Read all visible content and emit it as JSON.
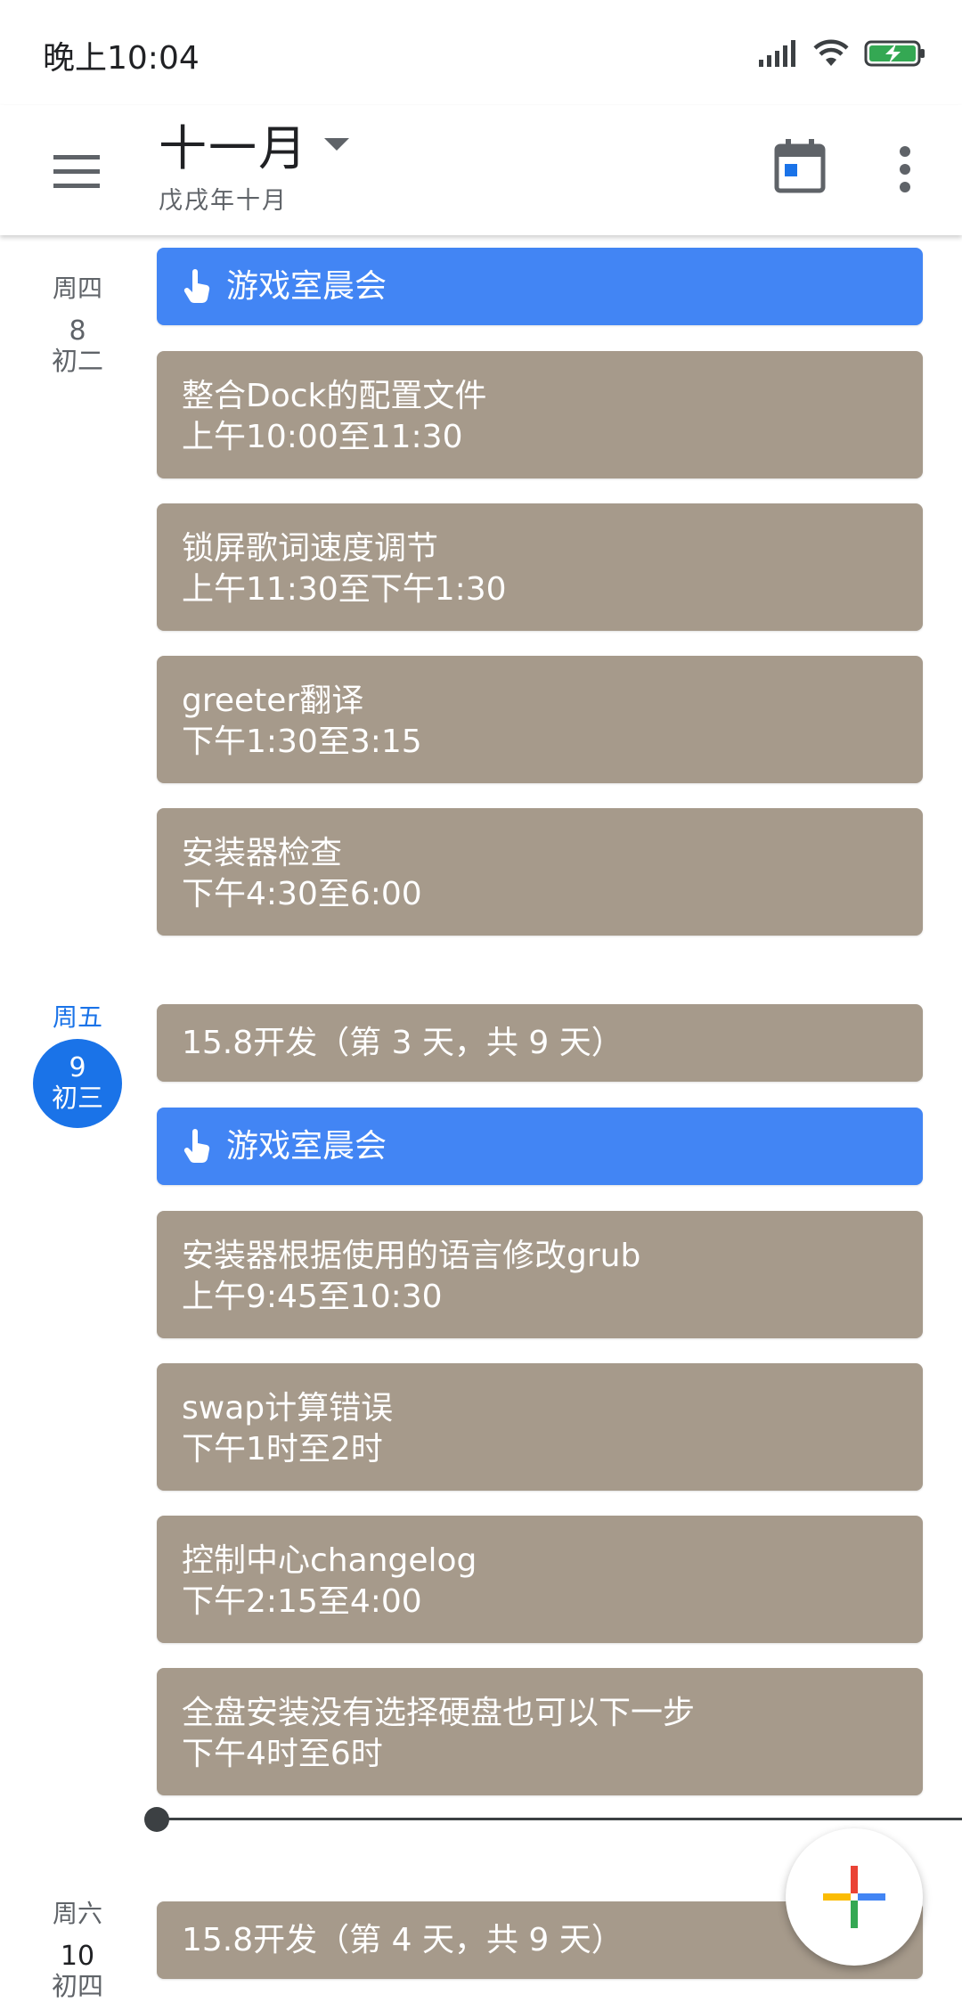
{
  "status_bar": {
    "time": "晚上10:04"
  },
  "header": {
    "month_title": "十一月",
    "lunar_subtitle": "戊戌年十月"
  },
  "days": [
    {
      "weekday": "周四",
      "date": "8",
      "lunar": "初二",
      "events": [
        {
          "title": "游戏室晨会",
          "time": "",
          "color": "#4285f4",
          "icon": "hand-pointer-icon"
        },
        {
          "title": "整合Dock的配置文件",
          "time": "上午10:00至11:30",
          "color": "#a69a8b"
        },
        {
          "title": "锁屏歌词速度调节",
          "time": "上午11:30至下午1:30",
          "color": "#a69a8b"
        },
        {
          "title": "greeter翻译",
          "time": "下午1:30至3:15",
          "color": "#a69a8b"
        },
        {
          "title": "安装器检查",
          "time": "下午4:30至6:00",
          "color": "#a69a8b"
        }
      ]
    },
    {
      "weekday": "周五",
      "date": "9",
      "lunar": "初三",
      "is_today": true,
      "events": [
        {
          "title": "15.8开发（第 3 天，共 9 天）",
          "time": "",
          "color": "#a69a8b"
        },
        {
          "title": "游戏室晨会",
          "time": "",
          "color": "#4285f4",
          "icon": "hand-pointer-icon"
        },
        {
          "title": "安装器根据使用的语言修改grub",
          "time": "上午9:45至10:30",
          "color": "#a69a8b"
        },
        {
          "title": "swap计算错误",
          "time": "下午1时至2时",
          "color": "#a69a8b"
        },
        {
          "title": "控制中心changelog",
          "time": "下午2:15至4:00",
          "color": "#a69a8b"
        },
        {
          "title": "全盘安装没有选择硬盘也可以下一步",
          "time": "下午4时至6时",
          "color": "#a69a8b"
        }
      ]
    },
    {
      "weekday": "周六",
      "date": "10",
      "lunar": "初四",
      "events": [
        {
          "title": "15.8开发（第 4 天，共 9 天）",
          "time": "",
          "color": "#a69a8b"
        }
      ]
    }
  ],
  "colors": {
    "accent": "#1a73e8",
    "event_blue": "#4285f4",
    "event_taupe": "#a69a8b"
  }
}
